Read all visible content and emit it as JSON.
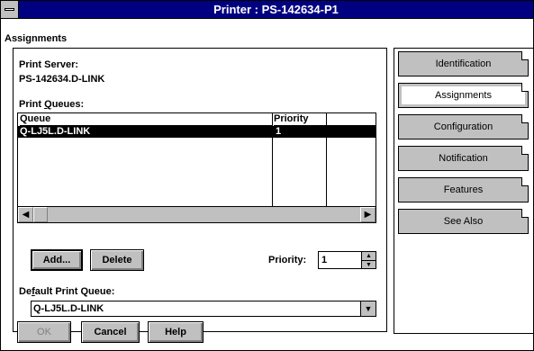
{
  "window": {
    "title": "Printer : PS-142634-P1"
  },
  "assignments": {
    "section_title": "Assignments",
    "print_server_label": "Print Server:",
    "print_server_value": "PS-142634.D-LINK",
    "print_queues_label_pre": "Print ",
    "print_queues_label_u": "Q",
    "print_queues_label_post": "ueues:",
    "columns": [
      "Queue",
      "Priority"
    ],
    "rows": [
      {
        "queue": "Q-LJ5L.D-LINK",
        "priority": "1"
      }
    ],
    "add_button": "Add...",
    "delete_button": "Delete",
    "priority_label": "Priority:",
    "priority_value": "1",
    "default_queue_label_pre": "De",
    "default_queue_label_u": "f",
    "default_queue_label_post": "ault Print Queue:",
    "default_queue_value": "Q-LJ5L.D-LINK"
  },
  "tabs": [
    "Identification",
    "Assignments",
    "Configuration",
    "Notification",
    "Features",
    "See Also"
  ],
  "active_tab": "Assignments",
  "footer": {
    "ok": "OK",
    "cancel": "Cancel",
    "help": "Help"
  }
}
